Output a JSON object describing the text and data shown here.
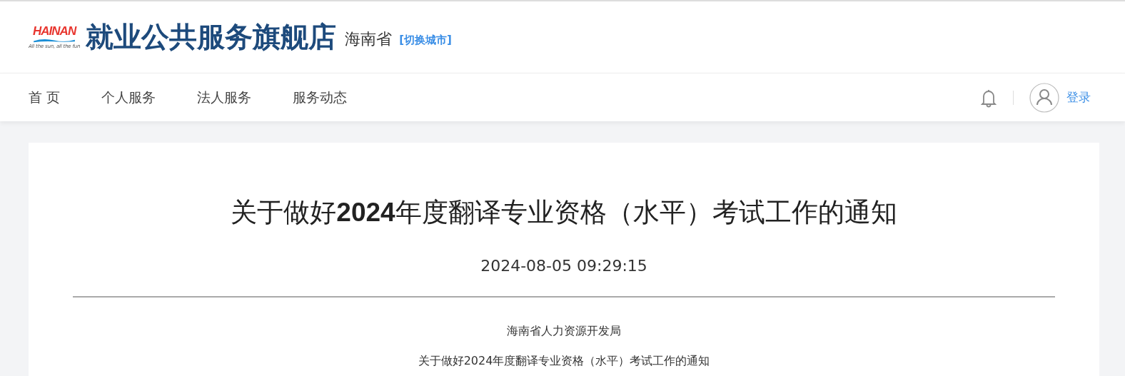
{
  "logo": {
    "text": "HAINAN",
    "tagline": "All the sun, all the fun"
  },
  "site_title": "就业公共服务旗舰店",
  "region": "海南省",
  "switch_city": "[切换城市]",
  "nav": [
    {
      "label": "首 页",
      "selected": false
    },
    {
      "label": "个人服务",
      "selected": false
    },
    {
      "label": "法人服务",
      "selected": false
    },
    {
      "label": "服务动态",
      "selected": false
    }
  ],
  "login": "登录",
  "article": {
    "title": "关于做好**2024**年度翻译专业资格（水平）考试工作的通知",
    "date": "2024-08-05 09:29:15",
    "paragraphs": [
      "海南省人力资源开发局",
      "关于做好2024年度翻译专业资格（水平）考试工作的通知"
    ]
  }
}
